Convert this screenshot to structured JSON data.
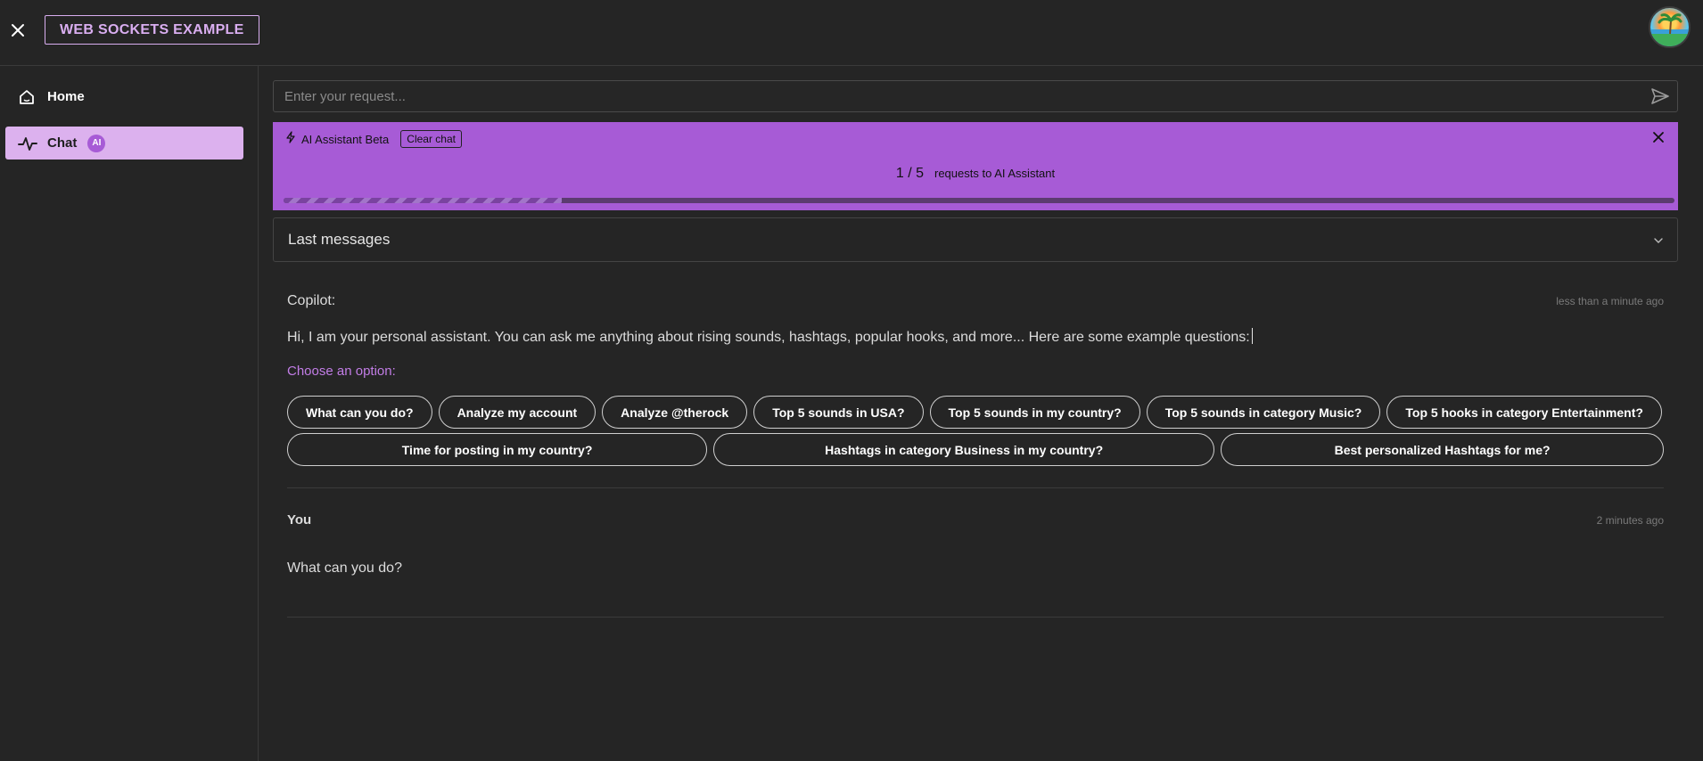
{
  "header": {
    "title": "WEB SOCKETS EXAMPLE"
  },
  "sidebar": {
    "items": [
      {
        "label": "Home",
        "icon": "home-icon"
      },
      {
        "label": "Chat",
        "icon": "activity-icon",
        "badge": "AI"
      }
    ]
  },
  "search": {
    "placeholder": "Enter your request...",
    "value": ""
  },
  "banner": {
    "title": "AI Assistant Beta",
    "clear_label": "Clear chat",
    "counter": "1 / 5",
    "counter_text": "requests to AI Assistant",
    "progress_fraction": 0.2
  },
  "accordion": {
    "label": "Last messages"
  },
  "messages": [
    {
      "sender": "Copilot:",
      "time": "less than a minute ago",
      "text": "Hi, I am your personal assistant. You can ask me anything about rising sounds, hashtags, popular hooks, and more... Here are some example questions:",
      "choose_label": "Choose an option:"
    },
    {
      "sender": "You",
      "time": "2 minutes ago",
      "text": "What can you do?"
    }
  ],
  "options_row1": [
    "What can you do?",
    "Analyze my account",
    "Analyze @therock",
    "Top 5 sounds in USA?",
    "Top 5 sounds in my country?",
    "Top 5 sounds in category Music?",
    "Top 5 hooks in category Entertainment?"
  ],
  "options_row2": [
    "Time for posting in my country?",
    "Hashtags in category Business in my country?",
    "Best personalized Hashtags for me?"
  ],
  "colors": {
    "background": "#252525",
    "accent": "#a75bd6",
    "active_nav": "#dcb1ee",
    "title_border": "#d9aef0"
  }
}
